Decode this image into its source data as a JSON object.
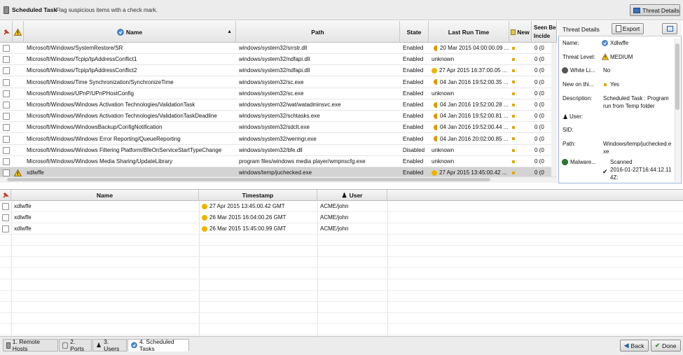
{
  "toolbar": {
    "title": "Scheduled Task",
    "subtitle": "Flag suspicious items with a check mark.",
    "threat_details_label": "Threat Details"
  },
  "upper_table": {
    "columns": {
      "name": "Name",
      "path": "Path",
      "state": "State",
      "last_run": "Last Run Time",
      "new": "New",
      "seen_line1": "Seen Be",
      "seen_line2": "Incide"
    },
    "rows": [
      {
        "name": "Microsoft/Windows/SystemRestore/SR",
        "path": "windows/system32/srrstr.dll",
        "state": "Enabled",
        "last_run": "20 Mar 2015 04:00:00.09 ...",
        "run_icon": "half",
        "seen": "0 (0"
      },
      {
        "name": "Microsoft/Windows/Tcpip/IpAddressConflict1",
        "path": "windows/system32/ndfapi.dll",
        "state": "Enabled",
        "last_run": "unknown",
        "run_icon": "none",
        "seen": "0 (0"
      },
      {
        "name": "Microsoft/Windows/Tcpip/IpAddressConflict2",
        "path": "windows/system32/ndfapi.dll",
        "state": "Enabled",
        "last_run": "27 Apr 2015 16:37:00.05 ...",
        "run_icon": "full",
        "seen": "0 (0"
      },
      {
        "name": "Microsoft/Windows/Time Synchronization/SynchronizeTime",
        "path": "windows/system32/sc.exe",
        "state": "Enabled",
        "last_run": "04 Jan 2016 19:52:00.35 ...",
        "run_icon": "half",
        "seen": "0 (0"
      },
      {
        "name": "Microsoft/Windows/UPnP/UPnPHostConfig",
        "path": "windows/system32/sc.exe",
        "state": "Enabled",
        "last_run": "unknown",
        "run_icon": "none",
        "seen": "0 (0"
      },
      {
        "name": "Microsoft/Windows/Windows Activation Technologies/ValidationTask",
        "path": "windows/system32/wat/watadminsvc.exe",
        "state": "Enabled",
        "last_run": "04 Jan 2016 19:52:00.28 ...",
        "run_icon": "half",
        "seen": "0 (0"
      },
      {
        "name": "Microsoft/Windows/Windows Activation Technologies/ValidationTaskDeadline",
        "path": "windows/system32/schtasks.exe",
        "state": "Enabled",
        "last_run": "04 Jan 2016 19:52:00.81 ...",
        "run_icon": "half",
        "seen": "0 (0"
      },
      {
        "name": "Microsoft/Windows/WindowsBackup/ConfigNotification",
        "path": "windows/system32/sdclt.exe",
        "state": "Enabled",
        "last_run": "04 Jan 2016 19:52:00.44 ...",
        "run_icon": "half",
        "seen": "0 (0"
      },
      {
        "name": "Microsoft/Windows/Windows Error Reporting/QueueReporting",
        "path": "windows/system32/wermgr.exe",
        "state": "Enabled",
        "last_run": "04 Jan 2016 20:02:00.85 ...",
        "run_icon": "half",
        "seen": "0 (0"
      },
      {
        "name": "Microsoft/Windows/Windows Filtering Platform/BfeOnServiceStartTypeChange",
        "path": "windows/system32/bfe.dll",
        "state": "Disabled",
        "last_run": "unknown",
        "run_icon": "none",
        "seen": "0 (0"
      },
      {
        "name": "Microsoft/Windows/Windows Media Sharing/UpdateLibrary",
        "path": "program files/windows media player/wmpnscfg.exe",
        "state": "Enabled",
        "last_run": "unknown",
        "run_icon": "none",
        "seen": "0 (0"
      },
      {
        "name": "xdlwffe",
        "path": "windows/temp/juchecked.exe",
        "state": "Enabled",
        "last_run": "27 Apr 2015 13:45:00.42 ...",
        "run_icon": "full",
        "seen": "0 (0",
        "selected": true,
        "warning": true
      }
    ]
  },
  "threat_details": {
    "title": "Threat Details",
    "export_label": "Export",
    "name_label": "Name:",
    "name_value": "Xdlwffe",
    "level_label": "Threat Level:",
    "level_value": "MEDIUM",
    "whitelist_label": "White Li...",
    "whitelist_value": "No",
    "new_label": "New on thi...",
    "new_value": "Yes",
    "desc_label": "Description:",
    "desc_value1": "Scheduled Task : Program",
    "desc_value2": "run from Temp folder",
    "user_label": "User:",
    "sid_label": "SID:",
    "path_label": "Path:",
    "path_value1": "Windows/temp/juchecked.e",
    "path_value2": "xe",
    "malware_label": "Malware...",
    "malware_value1": "Scanned",
    "malware_value2": "2016-01-22T16:44:12.11",
    "malware_value3": "4Z:"
  },
  "lower_table": {
    "columns": {
      "name": "Name",
      "timestamp": "Timestamp",
      "user": "User"
    },
    "rows": [
      {
        "name": "xdlwffe",
        "timestamp": "27 Apr 2015 13:45:00.42 GMT",
        "user": "ACME/john"
      },
      {
        "name": "xdlwffe",
        "timestamp": "26 Mar 2015 16:04:00.26 GMT",
        "user": "ACME/john"
      },
      {
        "name": "xdlwffe",
        "timestamp": "26 Mar 2015 15:45:00.99 GMT",
        "user": "ACME/john"
      }
    ]
  },
  "tabs": [
    {
      "label": "1. Remote Hosts"
    },
    {
      "label": "2. Ports"
    },
    {
      "label": "3. Users"
    },
    {
      "label": "4. Scheduled Tasks",
      "active": true
    }
  ],
  "nav": {
    "back_label": "Back",
    "done_label": "Done"
  },
  "colors": {
    "accent": "#3b6fb6",
    "warning": "#f0b400",
    "selected_row": "#d3d3d3"
  }
}
